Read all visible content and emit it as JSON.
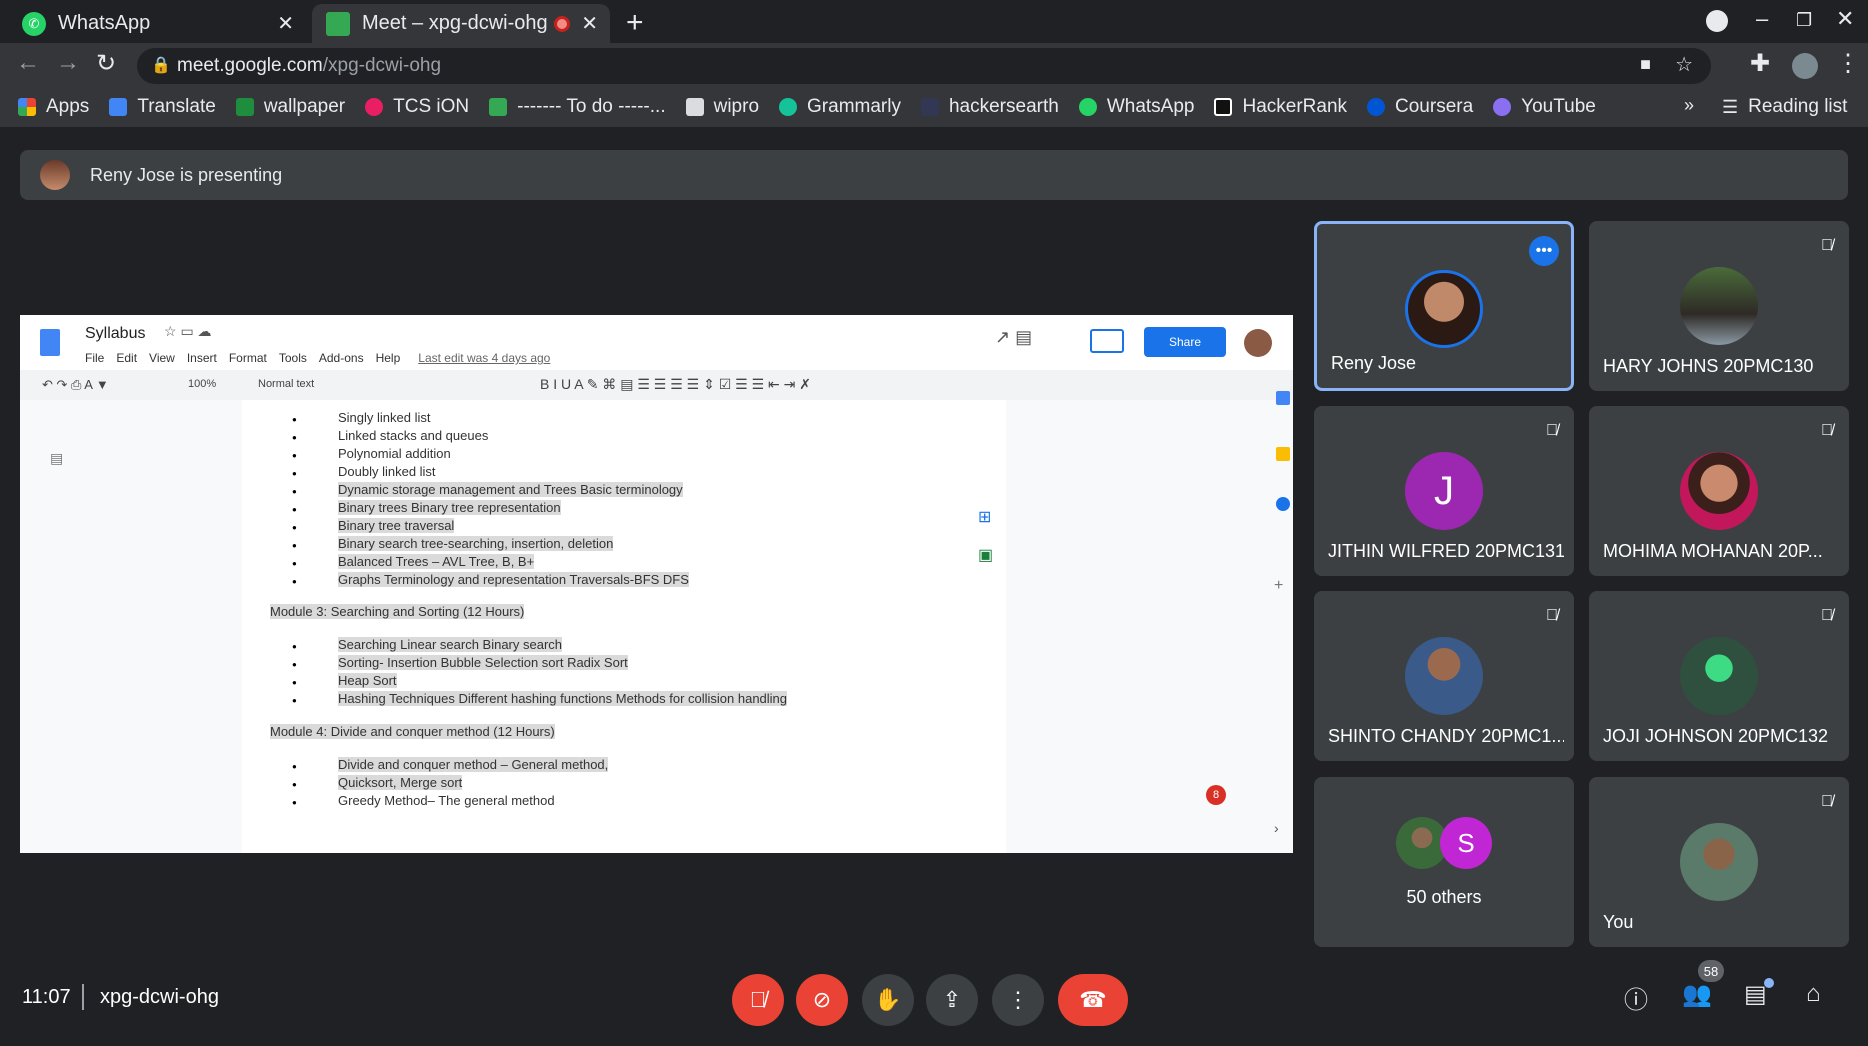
{
  "browser": {
    "tabs": [
      {
        "title": "WhatsApp",
        "active": false
      },
      {
        "title": "Meet – xpg-dcwi-ohg",
        "active": true
      }
    ],
    "url_host": "meet.google.com",
    "url_path": "/xpg-dcwi-ohg",
    "bookmarks": [
      "Apps",
      "Translate",
      "wallpaper",
      "TCS iON",
      "------- To do -----...",
      "wipro",
      "Grammarly",
      "hackersearth",
      "WhatsApp",
      "HackerRank",
      "Coursera",
      "YouTube"
    ],
    "more": "»",
    "reading_list": "Reading list"
  },
  "meet": {
    "presenting_banner": "Reny Jose is presenting",
    "time": "11:07",
    "meeting_code": "xpg-dcwi-ohg",
    "people_count": "58",
    "doc_badge": "8",
    "participants": [
      {
        "name": "Reny Jose",
        "muted": false,
        "active": true
      },
      {
        "name": "HARY JOHNS 20PMC130",
        "muted": true
      },
      {
        "name": "JITHIN WILFRED 20PMC131",
        "muted": true,
        "initial": "J"
      },
      {
        "name": "MOHIMA MOHANAN 20P...",
        "muted": true
      },
      {
        "name": "SHINTO CHANDY 20PMC1...",
        "muted": true
      },
      {
        "name": "JOJI JOHNSON 20PMC132",
        "muted": true
      },
      {
        "name": "50 others",
        "initial": "S"
      },
      {
        "name": "You",
        "muted": true
      }
    ]
  },
  "doc": {
    "title": "Syllabus",
    "menu": [
      "File",
      "Edit",
      "View",
      "Insert",
      "Format",
      "Tools",
      "Add-ons",
      "Help"
    ],
    "last_edit": "Last edit was 4 days ago",
    "share": "Share",
    "zoom": "100%",
    "style": "Normal text",
    "lines": [
      "Singly linked list",
      " Linked stacks and queues",
      "Polynomial addition",
      "Doubly linked list",
      " Dynamic storage management and  Trees Basic terminology",
      "Binary trees Binary tree representation",
      "Binary tree traversal",
      "Binary search tree-searching, insertion, deletion",
      "Balanced Trees – AVL Tree, B, B+",
      "Graphs Terminology and representation Traversals-BFS DFS",
      "Module 3: Searching and Sorting (12 Hours)",
      "Searching Linear search Binary search",
      " Sorting-  Insertion Bubble Selection sort  Radix Sort",
      "Heap Sort",
      "Hashing Techniques Different hashing functions Methods for collision handling",
      "Module 4: Divide and conquer method (12 Hours)",
      "Divide and conquer method – General method,",
      " Quicksort, Merge sort",
      " Greedy Method– The general method"
    ]
  },
  "colors": {
    "end_call": "#ea4335",
    "muted_red": "#ea4335",
    "accent_blue": "#8ab4f8"
  }
}
